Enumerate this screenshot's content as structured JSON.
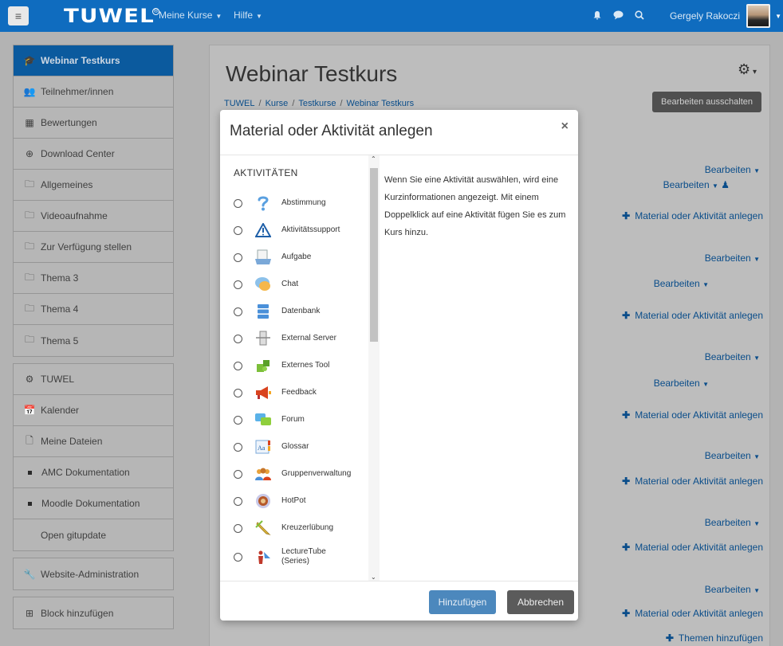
{
  "navbar": {
    "brand": "TUWEL",
    "brand_mark": "®",
    "menus": [
      "Meine Kurse",
      "Hilfe"
    ],
    "user_name": "Gergely Rakoczi",
    "icons": [
      "bell-icon",
      "chat-icon",
      "search-icon"
    ]
  },
  "sidebar": {
    "groups": [
      [
        {
          "label": "Webinar Testkurs",
          "icon": "graduation-cap-icon",
          "active": true
        },
        {
          "label": "Teilnehmer/innen",
          "icon": "users-icon"
        },
        {
          "label": "Bewertungen",
          "icon": "table-icon"
        },
        {
          "label": "Download Center",
          "icon": "download-icon"
        },
        {
          "label": "Allgemeines",
          "icon": "folder-icon"
        },
        {
          "label": "Videoaufnahme",
          "icon": "folder-icon"
        },
        {
          "label": "Zur Verfügung stellen",
          "icon": "folder-icon"
        },
        {
          "label": "Thema 3",
          "icon": "folder-icon"
        },
        {
          "label": "Thema 4",
          "icon": "folder-icon"
        },
        {
          "label": "Thema 5",
          "icon": "folder-icon"
        }
      ],
      [
        {
          "label": "TUWEL",
          "icon": "dashboard-icon"
        },
        {
          "label": "Kalender",
          "icon": "calendar-icon"
        },
        {
          "label": "Meine Dateien",
          "icon": "file-icon"
        },
        {
          "label": "AMC Dokumentation",
          "icon": "bullet-icon"
        },
        {
          "label": "Moodle Dokumentation",
          "icon": "bullet-icon"
        },
        {
          "label": "Open gitupdate",
          "icon": ""
        }
      ],
      [
        {
          "label": "Website-Administration",
          "icon": "wrench-icon"
        }
      ],
      [
        {
          "label": "Block hinzufügen",
          "icon": "plus-square-icon"
        }
      ]
    ]
  },
  "main": {
    "title": "Webinar Testkurs",
    "breadcrumb": [
      "TUWEL",
      "Kurse",
      "Testkurse",
      "Webinar Testkurs"
    ],
    "edit_toggle": "Bearbeiten ausschalten",
    "edit_label": "Bearbeiten",
    "add_activity": "Material oder Aktivität anlegen",
    "add_topics": "Themen hinzufügen"
  },
  "modal": {
    "title": "Material oder Aktivität anlegen",
    "close": "×",
    "section_heading": "AKTIVITÄTEN",
    "items": [
      {
        "label": "Abstimmung",
        "icon": "question-icon"
      },
      {
        "label": "Aktivitätssupport",
        "icon": "warning-icon"
      },
      {
        "label": "Aufgabe",
        "icon": "assignment-icon"
      },
      {
        "label": "Chat",
        "icon": "chat-bubble-icon"
      },
      {
        "label": "Datenbank",
        "icon": "database-icon"
      },
      {
        "label": "External Server",
        "icon": "server-icon"
      },
      {
        "label": "Externes Tool",
        "icon": "puzzle-icon"
      },
      {
        "label": "Feedback",
        "icon": "megaphone-icon"
      },
      {
        "label": "Forum",
        "icon": "forum-icon"
      },
      {
        "label": "Glossar",
        "icon": "glossary-icon"
      },
      {
        "label": "Gruppenverwaltung",
        "icon": "group-icon"
      },
      {
        "label": "HotPot",
        "icon": "hotpot-icon"
      },
      {
        "label": "Kreuzerlübung",
        "icon": "pencil-icon"
      },
      {
        "label": "LectureTube (Series)",
        "icon": "lecturer-icon"
      }
    ],
    "description": "Wenn Sie eine Aktivität auswählen, wird eine Kurzinformationen angezeigt. Mit einem Doppelklick auf eine Aktivität fügen Sie es zum Kurs hinzu.",
    "add_button": "Hinzufügen",
    "cancel_button": "Abbrechen"
  }
}
